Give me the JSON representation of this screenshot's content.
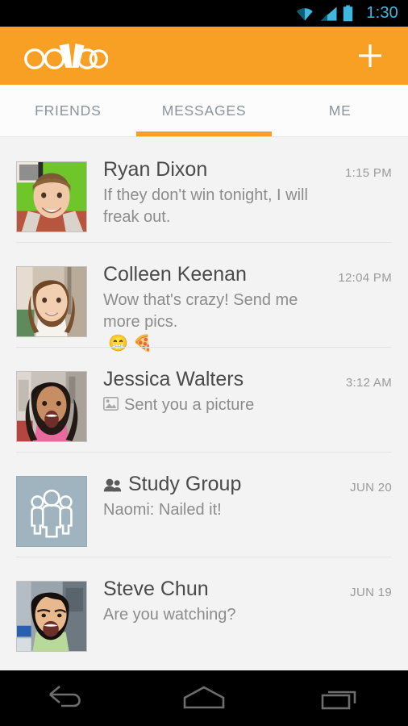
{
  "status_bar": {
    "time": "1:30",
    "accent_color": "#3fb8e0",
    "icons": [
      "wifi-icon",
      "cellular-signal-icon",
      "battery-icon"
    ]
  },
  "app_bar": {
    "brand": "ooVoo",
    "background_color": "#f7a024",
    "add_label": "+",
    "add_icon": "plus-icon"
  },
  "tabs": {
    "active_index": 1,
    "indicator_color": "#f7a024",
    "items": [
      {
        "label": "FRIENDS"
      },
      {
        "label": "MESSAGES"
      },
      {
        "label": "ME"
      }
    ]
  },
  "messages": [
    {
      "name": "Ryan Dixon",
      "preview": "If they don't win tonight, I will freak out.",
      "time": "1:15 PM",
      "avatar_type": "photo",
      "avatar_id": "ryan-dixon-avatar",
      "is_group": false,
      "has_attachment_icon": false,
      "emoji": ""
    },
    {
      "name": "Colleen Keenan",
      "preview": "Wow that's crazy! Send me more pics.",
      "time": "12:04 PM",
      "avatar_type": "photo",
      "avatar_id": "colleen-keenan-avatar",
      "is_group": false,
      "has_attachment_icon": false,
      "emoji": "😁 🍕"
    },
    {
      "name": "Jessica Walters",
      "preview": "Sent you a picture",
      "time": "3:12 AM",
      "avatar_type": "photo",
      "avatar_id": "jessica-walters-avatar",
      "is_group": false,
      "has_attachment_icon": true,
      "emoji": ""
    },
    {
      "name": "Study Group",
      "preview": "Naomi: Nailed it!",
      "time": "JUN 20",
      "avatar_type": "group-placeholder",
      "avatar_id": "study-group-avatar",
      "avatar_color": "#9fb4bf",
      "is_group": true,
      "has_attachment_icon": false,
      "emoji": ""
    },
    {
      "name": "Steve Chun",
      "preview": "Are you watching?",
      "time": "JUN 19",
      "avatar_type": "photo",
      "avatar_id": "steve-chun-avatar",
      "is_group": false,
      "has_attachment_icon": false,
      "emoji": ""
    }
  ],
  "nav_bar": {
    "buttons": [
      {
        "name": "back-icon",
        "label": "Back"
      },
      {
        "name": "home-icon",
        "label": "Home"
      },
      {
        "name": "recents-icon",
        "label": "Recents"
      }
    ]
  }
}
